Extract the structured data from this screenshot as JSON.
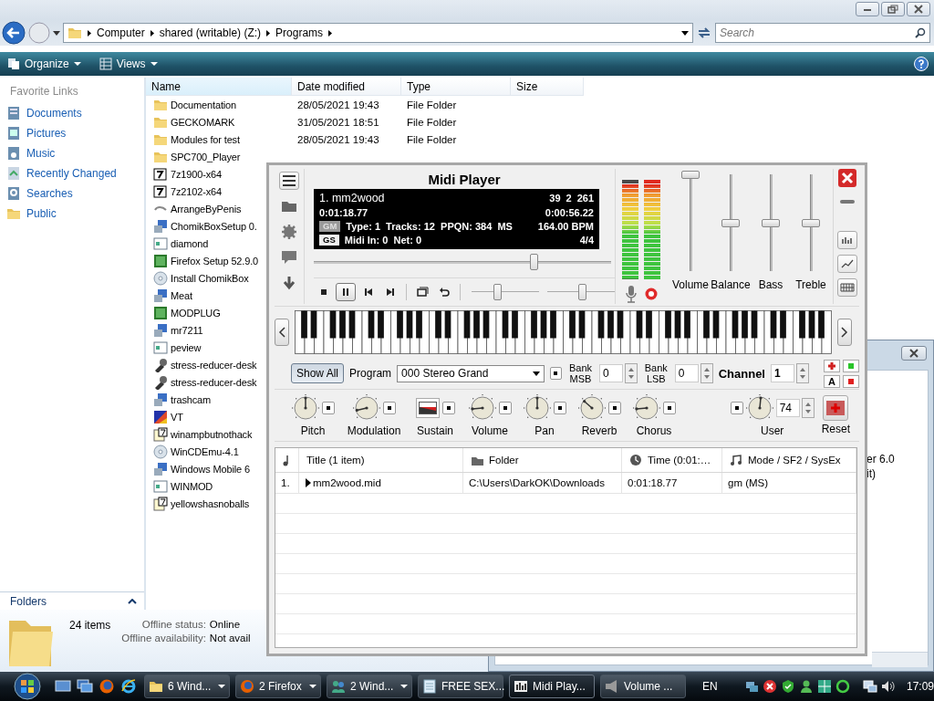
{
  "address": {
    "crumbs": [
      "Computer",
      "shared (writable) (Z:)",
      "Programs"
    ]
  },
  "search": {
    "placeholder": "Search"
  },
  "toolbar": {
    "items": [
      "Organize",
      "Views"
    ]
  },
  "favorite_links": {
    "title": "Favorite Links",
    "items": [
      {
        "label": "Documents",
        "kind": "documents"
      },
      {
        "label": "Pictures",
        "kind": "pictures"
      },
      {
        "label": "Music",
        "kind": "music"
      },
      {
        "label": "Recently Changed",
        "kind": "recent"
      },
      {
        "label": "Searches",
        "kind": "searches"
      },
      {
        "label": "Public",
        "kind": "folder"
      }
    ]
  },
  "file_list": {
    "columns": [
      "Name",
      "Date modified",
      "Type",
      "Size"
    ],
    "rows": [
      {
        "name": "Documentation",
        "date": "28/05/2021 19:43",
        "type": "File Folder",
        "kind": "folder"
      },
      {
        "name": "GECKOMARK",
        "date": "31/05/2021 18:51",
        "type": "File Folder",
        "kind": "folder"
      },
      {
        "name": "Modules for test",
        "date": "28/05/2021 19:43",
        "type": "File Folder",
        "kind": "folder"
      },
      {
        "name": "SPC700_Player",
        "kind": "folder"
      },
      {
        "name": "7z1900-x64",
        "kind": "archive"
      },
      {
        "name": "7z2102-x64",
        "kind": "archive"
      },
      {
        "name": "ArrangeByPenis",
        "kind": "shortcut"
      },
      {
        "name": "ChomikBoxSetup 0.",
        "kind": "installer"
      },
      {
        "name": "diamond",
        "kind": "exe"
      },
      {
        "name": "Firefox Setup 52.9.0",
        "kind": "green"
      },
      {
        "name": "Install ChomikBox",
        "kind": "disc"
      },
      {
        "name": "Meat",
        "kind": "installer"
      },
      {
        "name": "MODPLUG",
        "kind": "green"
      },
      {
        "name": "mr7211",
        "kind": "installer"
      },
      {
        "name": "peview",
        "kind": "exe"
      },
      {
        "name": "stress-reducer-desk",
        "kind": "tool"
      },
      {
        "name": "stress-reducer-desk",
        "kind": "tool"
      },
      {
        "name": "trashcam",
        "kind": "installer"
      },
      {
        "name": "VT",
        "kind": "colorful"
      },
      {
        "name": "winampbutnothack",
        "kind": "help"
      },
      {
        "name": "WinCDEmu-4.1",
        "kind": "disc"
      },
      {
        "name": "Windows Mobile 6",
        "kind": "installer"
      },
      {
        "name": "WINMOD",
        "kind": "exe"
      },
      {
        "name": "yellowshasnoballs",
        "kind": "help"
      }
    ]
  },
  "folders_bar": {
    "label": "Folders"
  },
  "details": {
    "count": "24 items",
    "fields": [
      {
        "label": "Offline status:",
        "value": "Online"
      },
      {
        "label": "Offline availability:",
        "value": "Not avail"
      }
    ]
  },
  "midi_player": {
    "title": "Midi Player",
    "display": {
      "track": "1. mm2wood",
      "counters": [
        "39",
        "2",
        "261"
      ],
      "elapsed": "0:01:18.77",
      "remaining": "0:00:56.22",
      "badges": [
        {
          "label": "GM",
          "on": false
        },
        {
          "label": "GS",
          "on": true
        }
      ],
      "info": "Type: 1  Tracks: 12  PPQN: 384  MS",
      "tempo": "164.00 BPM",
      "midi_info": "Midi In: 0  Net: 0",
      "time_signature": "4/4"
    },
    "position": {
      "level": 0.74
    },
    "transport": [
      {
        "kind": "stop",
        "selected": false
      },
      {
        "kind": "pause",
        "selected": true
      },
      {
        "kind": "previous",
        "selected": false
      },
      {
        "kind": "next",
        "selected": false
      },
      {
        "kind": "window",
        "selected": false
      },
      {
        "kind": "repeat",
        "selected": false
      }
    ],
    "small_sliders": [
      {
        "level": 0.38
      },
      {
        "level": 0.52
      }
    ],
    "vu_meters": [
      {
        "level": 0.95
      },
      {
        "level": 1.0
      }
    ],
    "mixer": [
      {
        "label": "Volume",
        "level": 1.0
      },
      {
        "label": "Balance",
        "level": 0.5
      },
      {
        "label": "Bass",
        "level": 0.5
      },
      {
        "label": "Treble",
        "level": 0.5
      }
    ],
    "controls": {
      "show_all": {
        "label": "Show All",
        "selected": true
      },
      "program_label": "Program",
      "program": "000 Stereo Grand",
      "banks": [
        {
          "label": "Bank MSB",
          "value": "0"
        },
        {
          "label": "Bank LSB",
          "value": "0"
        }
      ],
      "channel": {
        "label": "Channel",
        "value": "1"
      },
      "letter_button": "A"
    },
    "knobs": [
      {
        "label": "Pitch",
        "kind": "knob",
        "level": 0.5
      },
      {
        "label": "Modulation",
        "kind": "knob",
        "level": 0.12
      },
      {
        "label": "Sustain",
        "kind": "toggle",
        "on": true
      },
      {
        "label": "Volume",
        "kind": "knob",
        "level": 0.15
      },
      {
        "label": "Pan",
        "kind": "knob",
        "level": 0.5
      },
      {
        "label": "Reverb",
        "kind": "knob",
        "level": 0.32
      },
      {
        "label": "Chorus",
        "kind": "knob",
        "level": 0.15
      },
      {
        "label": "User",
        "kind": "user_knob",
        "level": 0.52,
        "value": "74"
      }
    ],
    "reset": "Reset",
    "playlist": {
      "columns": [
        "Title (1 item)",
        "Folder",
        "Time (0:01:…",
        "Mode / SF2 / SysEx"
      ],
      "rows": [
        {
          "number": "1.",
          "title": "mm2wood.mid",
          "folder": "C:\\Users\\DarkOK\\Downloads",
          "time": "0:01:18.77",
          "mode": "gm (MS)",
          "playing": true
        }
      ]
    }
  },
  "back_dialog": {
    "texts": [
      "er 6.0",
      "it)"
    ]
  },
  "taskbar": {
    "tasks": [
      {
        "label": "6 Wind...",
        "kind": "folder",
        "grouped": true,
        "selected": false
      },
      {
        "label": "2 Firefox",
        "kind": "firefox",
        "grouped": true,
        "selected": false
      },
      {
        "label": "2 Wind...",
        "kind": "people",
        "grouped": true,
        "selected": false
      },
      {
        "label": "FREE SEX...",
        "kind": "notepad",
        "grouped": false,
        "selected": false
      },
      {
        "label": "Midi Play...",
        "kind": "midi",
        "grouped": false,
        "selected": true
      },
      {
        "label": "Volume ...",
        "kind": "volume",
        "grouped": false,
        "selected": false
      }
    ],
    "language": "EN",
    "clock": "17:09"
  }
}
